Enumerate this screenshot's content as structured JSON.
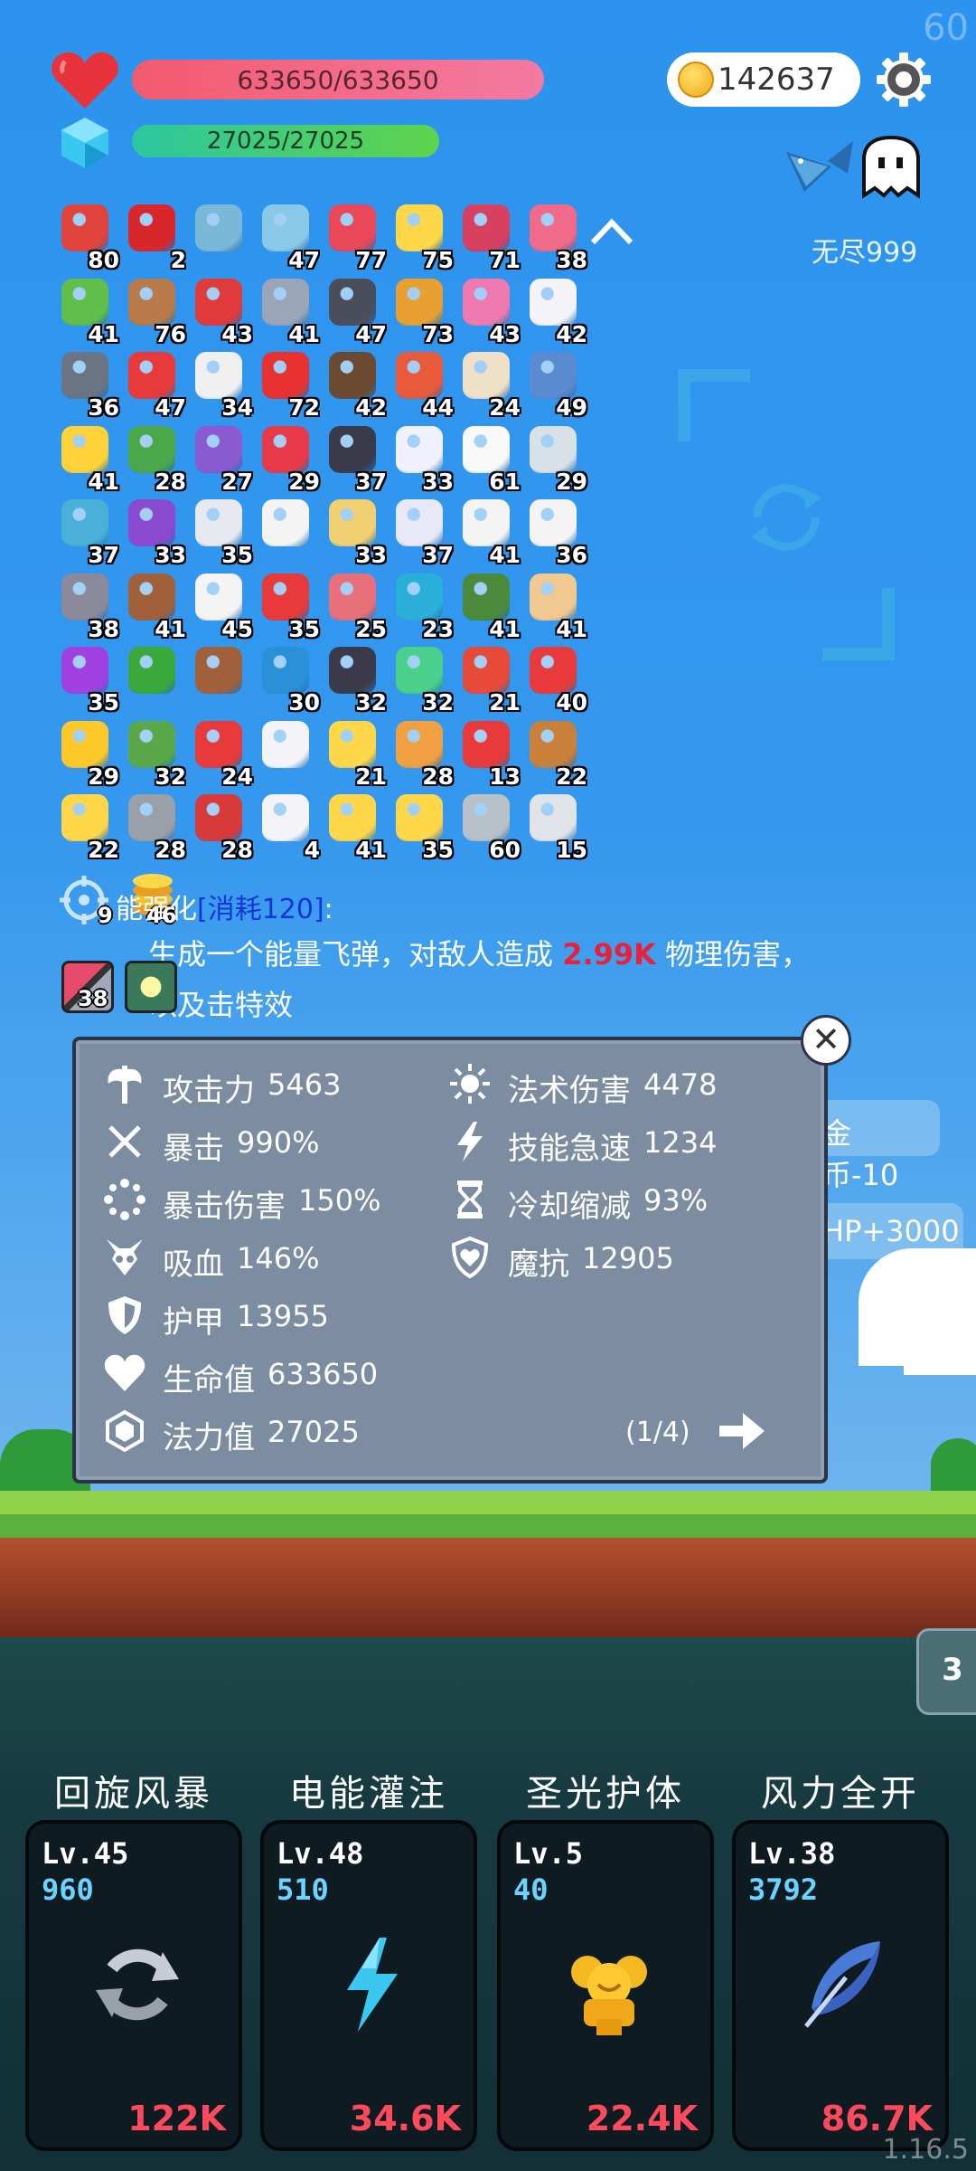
{
  "hud": {
    "fps": "60",
    "hp_text": "633650/633650",
    "mp_text": "27025/27025",
    "coins": "142637",
    "mode_label": "无尽999",
    "version": "1.16.5"
  },
  "items": [
    {
      "icon": "sock-icon",
      "count": "80",
      "color": "#e0443c"
    },
    {
      "icon": "magnet-icon",
      "count": "2",
      "color": "#d8262b"
    },
    {
      "icon": "magnifier-icon",
      "count": "",
      "color": "#7ab8d8"
    },
    {
      "icon": "potion-flask-icon",
      "count": "47",
      "color": "#8ac8e8"
    },
    {
      "icon": "watermelon-icon",
      "count": "77",
      "color": "#e84858"
    },
    {
      "icon": "star-card-icon",
      "count": "75",
      "color": "#ffd84a"
    },
    {
      "icon": "jam-jar-icon",
      "count": "71",
      "color": "#d84060"
    },
    {
      "icon": "spray-bottle-icon",
      "count": "38",
      "color": "#f06a8a"
    },
    {
      "icon": "money-heart-icon",
      "count": "41",
      "color": "#5fbf4a"
    },
    {
      "icon": "donut-icon",
      "count": "76",
      "color": "#b87a4a"
    },
    {
      "icon": "mushroom-icon",
      "count": "43",
      "color": "#e03a3a"
    },
    {
      "icon": "elephant-icon",
      "count": "41",
      "color": "#9aa6b8"
    },
    {
      "icon": "bat-icon",
      "count": "47",
      "color": "#4a4e5a"
    },
    {
      "icon": "book-icon",
      "count": "73",
      "color": "#e8a030"
    },
    {
      "icon": "ice-cream-icon",
      "count": "43",
      "color": "#f07ab0"
    },
    {
      "icon": "ghost-icon",
      "count": "42",
      "color": "#f4f4f8"
    },
    {
      "icon": "spiked-ball-icon",
      "count": "36",
      "color": "#6a7484"
    },
    {
      "icon": "strawberry-icon",
      "count": "47",
      "color": "#e83a3a"
    },
    {
      "icon": "dice-icon",
      "count": "34",
      "color": "#f0f0f0"
    },
    {
      "icon": "apple-icon",
      "count": "72",
      "color": "#e83232"
    },
    {
      "icon": "coconut-icon",
      "count": "42",
      "color": "#6a4a30"
    },
    {
      "icon": "test-tube-icon",
      "count": "44",
      "color": "#e85a3a"
    },
    {
      "icon": "bomb-flask-icon",
      "count": "24",
      "color": "#f0e0c8"
    },
    {
      "icon": "shield-icon",
      "count": "49",
      "color": "#5a8ad0"
    },
    {
      "icon": "fried-egg-icon",
      "count": "41",
      "color": "#ffd23a"
    },
    {
      "icon": "leaf-icon",
      "count": "28",
      "color": "#4aa84a"
    },
    {
      "icon": "star-shield-icon",
      "count": "27",
      "color": "#8a5ad0"
    },
    {
      "icon": "heart-icon",
      "count": "29",
      "color": "#e83a4a"
    },
    {
      "icon": "cauldron-icon",
      "count": "37",
      "color": "#3a3a4a"
    },
    {
      "icon": "halo-icon",
      "count": "33",
      "color": "#f0f0ff"
    },
    {
      "icon": "flower-icon",
      "count": "61",
      "color": "#f8f8f8"
    },
    {
      "icon": "stopwatch-icon",
      "count": "29",
      "color": "#d8e0e8"
    },
    {
      "icon": "scroll-icon",
      "count": "37",
      "color": "#4ab0d8"
    },
    {
      "icon": "purple-chest-icon",
      "count": "33",
      "color": "#8a4ad0"
    },
    {
      "icon": "half-moon-icon",
      "count": "35",
      "color": "#e8e8f0"
    },
    {
      "icon": "checklist-icon",
      "count": "",
      "color": "#f4f4f4"
    },
    {
      "icon": "note-pencil-icon",
      "count": "33",
      "color": "#f0d070"
    },
    {
      "icon": "pill-icon",
      "count": "37",
      "color": "#e8e8f8"
    },
    {
      "icon": "envelope-icon",
      "count": "41",
      "color": "#f4f4f4"
    },
    {
      "icon": "playing-cards-icon",
      "count": "36",
      "color": "#f4f4f4"
    },
    {
      "icon": "meteor-icon",
      "count": "38",
      "color": "#8a8a9a"
    },
    {
      "icon": "door-icon",
      "count": "41",
      "color": "#a0603a"
    },
    {
      "icon": "clipboard-icon",
      "count": "45",
      "color": "#f4f4f4"
    },
    {
      "icon": "gift-box-icon",
      "count": "35",
      "color": "#e83a3a"
    },
    {
      "icon": "steak-icon",
      "count": "25",
      "color": "#e8707a"
    },
    {
      "icon": "gem-icon",
      "count": "23",
      "color": "#2ab0d8"
    },
    {
      "icon": "grenade-icon",
      "count": "41",
      "color": "#4a8a3a"
    },
    {
      "icon": "fist-icon",
      "count": "41",
      "color": "#f0c890"
    },
    {
      "icon": "purple-orb-icon",
      "count": "35",
      "color": "#a040e0"
    },
    {
      "icon": "green-card-icon",
      "count": "",
      "color": "#3aa83a"
    },
    {
      "icon": "treasure-chest-icon",
      "count": "",
      "color": "#a0603a"
    },
    {
      "icon": "speech-bubble-icon",
      "count": "30",
      "color": "#2a90d8"
    },
    {
      "icon": "vinyl-record-icon",
      "count": "32",
      "color": "#3a3a4a"
    },
    {
      "icon": "green-blob-icon",
      "count": "32",
      "color": "#4ad08a"
    },
    {
      "icon": "matchstick-icon",
      "count": "21",
      "color": "#e84a3a"
    },
    {
      "icon": "red-badge-icon",
      "count": "40",
      "color": "#e83a3a"
    },
    {
      "icon": "sunflower-icon",
      "count": "29",
      "color": "#ffc82a"
    },
    {
      "icon": "zombie-icon",
      "count": "32",
      "color": "#5aa84a"
    },
    {
      "icon": "red-card-icon",
      "count": "24",
      "color": "#e83a3a"
    },
    {
      "icon": "wing-icon",
      "count": "",
      "color": "#f4f4f8"
    },
    {
      "icon": "magic-wand-icon",
      "count": "21",
      "color": "#ffd84a"
    },
    {
      "icon": "parchment-icon",
      "count": "28",
      "color": "#f0a040"
    },
    {
      "icon": "heart-broken-icon",
      "count": "13",
      "color": "#e83a3a"
    },
    {
      "icon": "bow-arrow-icon",
      "count": "22",
      "color": "#c8803a"
    },
    {
      "icon": "ring-icon",
      "count": "22",
      "color": "#ffd84a"
    },
    {
      "icon": "compass-icon",
      "count": "28",
      "color": "#9aa0a8"
    },
    {
      "icon": "crest-shield-icon",
      "count": "28",
      "color": "#d83a3a"
    },
    {
      "icon": "chat-dots-icon",
      "count": "4",
      "color": "#f4f4f8"
    },
    {
      "icon": "crown-icon",
      "count": "41",
      "color": "#ffd84a"
    },
    {
      "icon": "sun-cloud-icon",
      "count": "35",
      "color": "#ffd84a"
    },
    {
      "icon": "sword-icon",
      "count": "60",
      "color": "#b8c0c8"
    },
    {
      "icon": "hook-icon",
      "count": "15",
      "color": "#e0e4e8"
    }
  ],
  "description": {
    "title_suffix": "能强化",
    "cost": "[消耗120]",
    "colon": ":",
    "text_before": "生成一个能量飞弹，对敌人造成 ",
    "damage": "2.99K",
    "text_after": " 物理伤害，",
    "line3": "以及击特效",
    "target_count": "9",
    "coins_count": "46",
    "item_a_count": "38",
    "item_b_count": ""
  },
  "floating": {
    "gold_minus": "金币-10",
    "hp_plus": "HP+3000"
  },
  "stats": {
    "left": [
      {
        "icon": "axe-icon",
        "name": "攻击力",
        "value": "5463"
      },
      {
        "icon": "crit-cross-icon",
        "name": "暴击",
        "value": "990%"
      },
      {
        "icon": "crit-dmg-circle-icon",
        "name": "暴击伤害",
        "value": "150%"
      },
      {
        "icon": "skull-lifesteal-icon",
        "name": "吸血",
        "value": "146%"
      },
      {
        "icon": "armor-shield-icon",
        "name": "护甲",
        "value": "13955"
      },
      {
        "icon": "heart-icon",
        "name": "生命值",
        "value": "633650"
      },
      {
        "icon": "mana-gem-icon",
        "name": "法力值",
        "value": "27025"
      }
    ],
    "right": [
      {
        "icon": "sun-spell-icon",
        "name": "法术伤害",
        "value": "4478"
      },
      {
        "icon": "lightning-haste-icon",
        "name": "技能急速",
        "value": "1234"
      },
      {
        "icon": "hourglass-icon",
        "name": "冷却缩减",
        "value": "93%"
      },
      {
        "icon": "magic-resist-shield-icon",
        "name": "魔抗",
        "value": "12905"
      }
    ],
    "page": "(1/4)",
    "close_glyph": "✕"
  },
  "side_tab": "3",
  "skills": [
    {
      "name": "回旋风暴",
      "level": "Lv.45",
      "cost": "960",
      "damage": "122K",
      "icon": "whirlwind-icon"
    },
    {
      "name": "电能灌注",
      "level": "Lv.48",
      "cost": "510",
      "damage": "34.6K",
      "icon": "lightning-icon"
    },
    {
      "name": "圣光护体",
      "level": "Lv.5",
      "cost": "40",
      "damage": "22.4K",
      "icon": "holy-light-icon"
    },
    {
      "name": "风力全开",
      "level": "Lv.38",
      "cost": "3792",
      "damage": "86.7K",
      "icon": "feather-icon"
    }
  ]
}
